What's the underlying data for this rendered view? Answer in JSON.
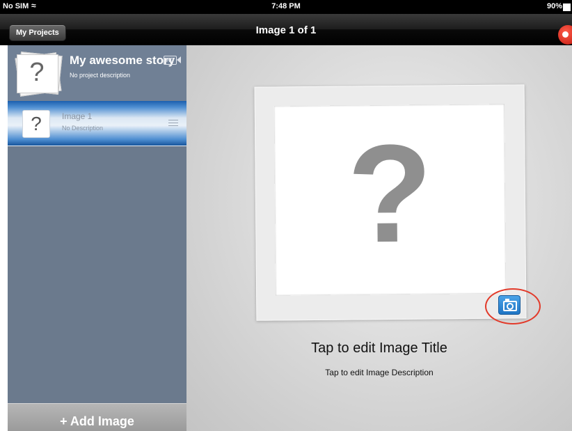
{
  "status_bar": {
    "carrier": "No SIM",
    "time": "7:48 PM",
    "battery": "90%"
  },
  "nav": {
    "back_label": "My Projects",
    "title": "Image 1 of 1"
  },
  "sidebar": {
    "project": {
      "title": "My awesome story",
      "badge": "HD",
      "description": "No project description",
      "thumb_glyph": "?"
    },
    "images": [
      {
        "title": "Image 1",
        "description": "No Description",
        "thumb_glyph": "?",
        "selected": true
      }
    ],
    "add_label": "+ Add Image"
  },
  "main": {
    "placeholder_glyph": "?",
    "title": "Tap to edit Image Title",
    "description": "Tap to edit Image Description"
  },
  "colors": {
    "selection_blue": "#4f8fd2",
    "camera_blue": "#1f75c4",
    "annotation_red": "#e23a2a",
    "record_red": "#c0160c"
  },
  "icons": [
    "wifi-icon",
    "battery-icon",
    "record-icon",
    "hd-video-icon",
    "drag-handle-icon",
    "camera-icon"
  ]
}
